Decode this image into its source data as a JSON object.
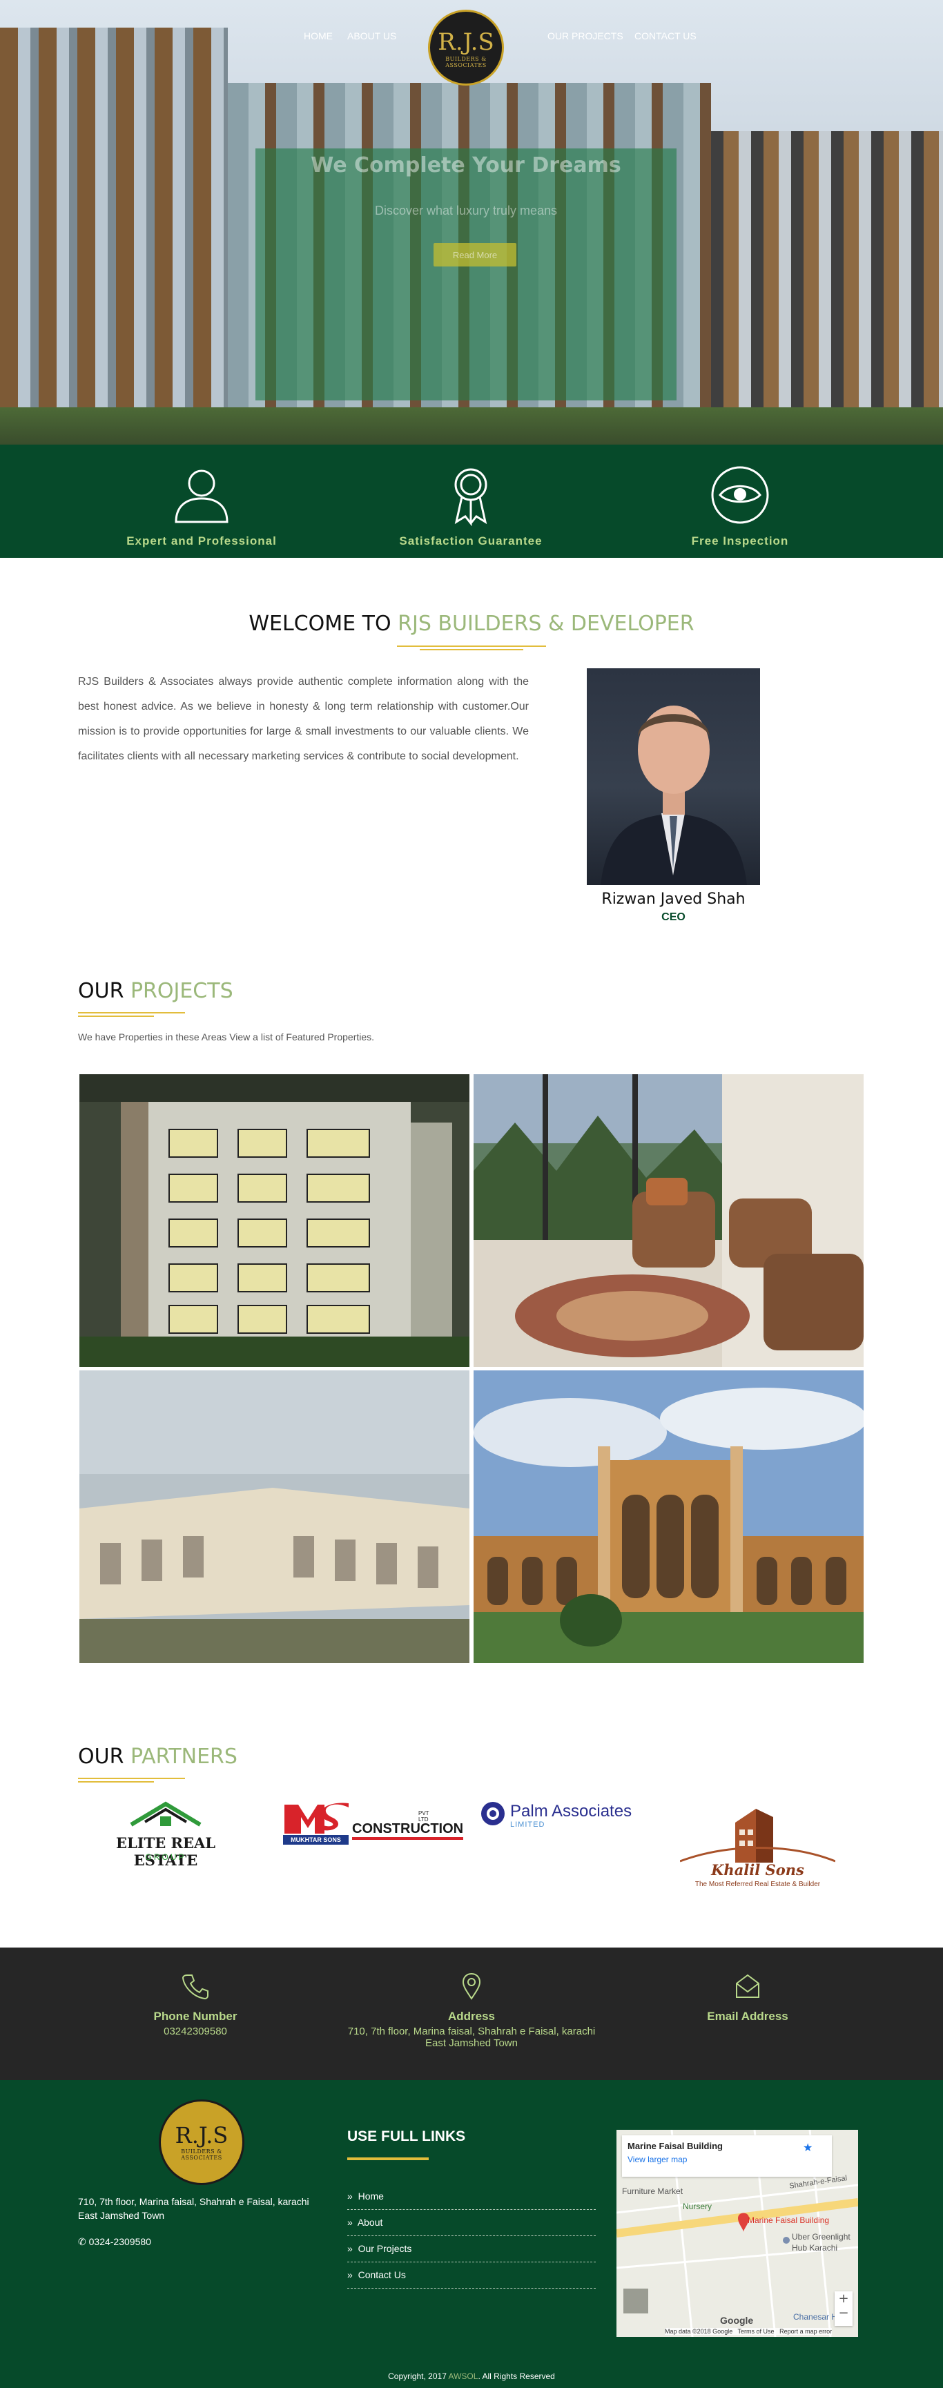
{
  "nav": {
    "home": "HOME",
    "about": "ABOUT US",
    "projects": "OUR PROJECTS",
    "contact": "CONTACT US"
  },
  "logo": {
    "main": "R.J.S",
    "small": "BUILDERS & ASSOCIATES"
  },
  "hero": {
    "title": "We Complete Your Dreams",
    "subtitle": "Discover what luxury truly means",
    "button": "Read More"
  },
  "features": [
    {
      "label": "Expert and Professional",
      "icon": "user-icon"
    },
    {
      "label": "Satisfaction Guarantee",
      "icon": "award-icon"
    },
    {
      "label": "Free Inspection",
      "icon": "eye-icon"
    }
  ],
  "welcome": {
    "title_prefix": "WELCOME TO ",
    "title_accent": "RJS BUILDERS & DEVELOPER",
    "body": "RJS Builders & Associates always provide authentic complete information along with the best honest advice. As we believe in honesty & long term relationship with customer.Our mission is to provide opportunities for large & small investments to our valuable clients. We facilitates clients with all necessary marketing services & contribute to social development."
  },
  "ceo": {
    "name": "Rizwan Javed Shah",
    "role": "CEO"
  },
  "projects": {
    "title_prefix": "OUR ",
    "title_accent": "PROJECTS",
    "subtitle": "We have Properties in these Areas View a list of Featured Properties."
  },
  "partners": {
    "title_prefix": "OUR ",
    "title_accent": "PARTNERS",
    "items": [
      {
        "name": "ELITE REAL ESTATE",
        "sub": "GROUP"
      },
      {
        "name": "MUKHTAR SONS",
        "sub": "CONSTRUCTION",
        "suffix": "PVT LTD"
      },
      {
        "name": "Palm Associates",
        "sub": "LIMITED"
      },
      {
        "name": "Khalil Sons",
        "sub": "The Most Referred Real Estate & Builder"
      }
    ]
  },
  "contact": {
    "phone_label": "Phone Number",
    "phone": "03242309580",
    "address_label": "Address",
    "address_line1": "710, 7th floor, Marina faisal, Shahrah e Faisal, karachi",
    "address_line2": "East Jamshed Town",
    "email_label": "Email Address"
  },
  "footer": {
    "address_line1": "710, 7th floor, Marina faisal, Shahrah e Faisal, karachi",
    "address_line2": "East Jamshed Town",
    "phone": "0324-2309580",
    "links_title": "USE FULL LINKS",
    "links": [
      "Home",
      "About",
      "Our Projects",
      "Contact Us"
    ],
    "map": {
      "place": "Marine Faisal Building",
      "link": "View larger map",
      "pin_label": "Marine Faisal Building",
      "labels": [
        "Furniture Market",
        "Nursery",
        "Uber Greenlight",
        "Hub Karachi",
        "Chanesar Halt",
        "Shahrah-e-Faisal"
      ],
      "google": "Google",
      "data": "Map data ©2018 Google",
      "terms": "Terms of Use",
      "report": "Report a map error"
    },
    "copyright_prefix": "Copyright, 2017 ",
    "copyright_brand": "AWSOL",
    "copyright_suffix": ". All Rights Reserved"
  }
}
